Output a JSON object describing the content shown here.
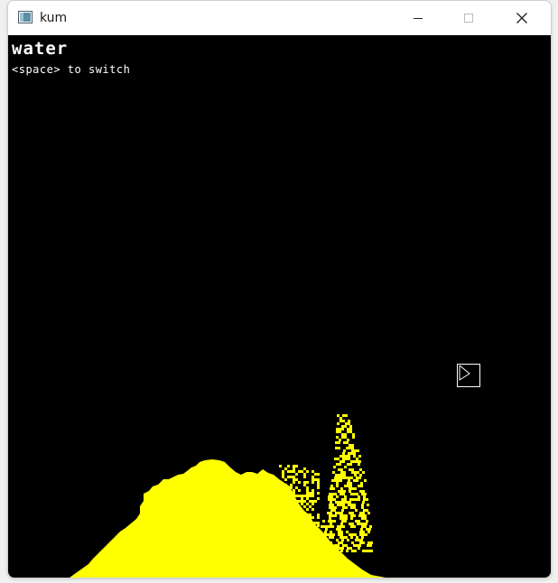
{
  "window": {
    "title": "kum"
  },
  "hud": {
    "material": "water",
    "hint": "<space> to switch"
  },
  "colors": {
    "sand": "#ffff00",
    "background": "#000000"
  },
  "icons": [
    "app-icon",
    "minimize-icon",
    "maximize-icon",
    "close-icon",
    "cursor-icon"
  ]
}
